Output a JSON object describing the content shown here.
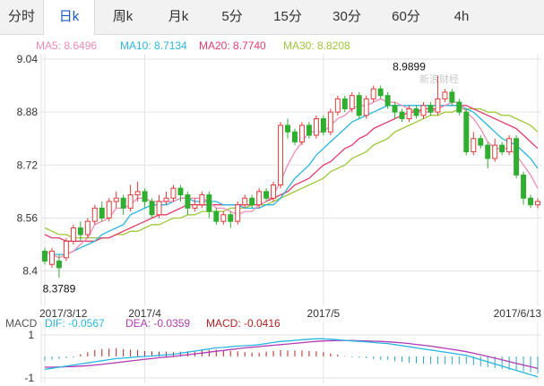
{
  "tabs": [
    {
      "label": "分时",
      "active": false
    },
    {
      "label": "日k",
      "active": true
    },
    {
      "label": "周k",
      "active": false
    },
    {
      "label": "月k",
      "active": false
    },
    {
      "label": "5分",
      "active": false
    },
    {
      "label": "15分",
      "active": false
    },
    {
      "label": "30分",
      "active": false
    },
    {
      "label": "60分",
      "active": false
    },
    {
      "label": "4h",
      "active": false
    }
  ],
  "ma_legend": [
    {
      "label": "MA5: 8.6496",
      "color": "#f08cb4"
    },
    {
      "label": "MA10: 8.7134",
      "color": "#29b6e0"
    },
    {
      "label": "MA20: 8.7740",
      "color": "#e33c6e"
    },
    {
      "label": "MA30: 8.8208",
      "color": "#9ec73a"
    }
  ],
  "macd_legend": {
    "title": "MACD",
    "items": [
      {
        "label": "DIF: -0.0567",
        "color": "#29b6e0"
      },
      {
        "label": "DEA: -0.0359",
        "color": "#b23ab4"
      },
      {
        "label": "MACD: -0.0416",
        "color": "#b22222"
      }
    ]
  },
  "watermark": "新浪财经",
  "colors": {
    "up": "#e23b3b",
    "down": "#2fae2f",
    "grid": "#e3e3e3"
  },
  "chart_data": {
    "type": "candlestick",
    "y_ticks": [
      "9.04",
      "8.88",
      "8.72",
      "8.56",
      "8.4"
    ],
    "ylim": [
      8.38,
      9.04
    ],
    "x_labels": [
      {
        "label": "2017/3/12",
        "index": 0
      },
      {
        "label": "2017/4",
        "index": 14
      },
      {
        "label": "2017/5",
        "index": 39
      },
      {
        "label": "2017/6/13",
        "index": 69
      }
    ],
    "annotations": [
      {
        "label": "8.9899",
        "value": 8.9899,
        "index": 51,
        "kind": "high"
      },
      {
        "label": "8.3789",
        "value": 8.3789,
        "index": 2,
        "kind": "low"
      }
    ],
    "candles": [
      [
        8.46,
        8.43,
        8.47,
        8.42
      ],
      [
        8.42,
        8.46,
        8.47,
        8.41
      ],
      [
        8.43,
        8.41,
        8.45,
        8.38
      ],
      [
        8.44,
        8.49,
        8.5,
        8.43
      ],
      [
        8.49,
        8.53,
        8.54,
        8.48
      ],
      [
        8.53,
        8.51,
        8.55,
        8.49
      ],
      [
        8.51,
        8.55,
        8.56,
        8.5
      ],
      [
        8.55,
        8.59,
        8.6,
        8.54
      ],
      [
        8.59,
        8.56,
        8.61,
        8.55
      ],
      [
        8.56,
        8.61,
        8.62,
        8.55
      ],
      [
        8.61,
        8.62,
        8.64,
        8.59
      ],
      [
        8.62,
        8.59,
        8.63,
        8.57
      ],
      [
        8.59,
        8.63,
        8.66,
        8.58
      ],
      [
        8.63,
        8.64,
        8.67,
        8.61
      ],
      [
        8.64,
        8.61,
        8.65,
        8.59
      ],
      [
        8.61,
        8.57,
        8.62,
        8.56
      ],
      [
        8.57,
        8.61,
        8.63,
        8.56
      ],
      [
        8.61,
        8.62,
        8.64,
        8.6
      ],
      [
        8.62,
        8.65,
        8.66,
        8.61
      ],
      [
        8.65,
        8.63,
        8.66,
        8.61
      ],
      [
        8.63,
        8.59,
        8.64,
        8.57
      ],
      [
        8.59,
        8.6,
        8.62,
        8.58
      ],
      [
        8.6,
        8.63,
        8.64,
        8.59
      ],
      [
        8.63,
        8.58,
        8.64,
        8.56
      ],
      [
        8.58,
        8.55,
        8.59,
        8.54
      ],
      [
        8.55,
        8.57,
        8.58,
        8.54
      ],
      [
        8.57,
        8.55,
        8.58,
        8.53
      ],
      [
        8.55,
        8.6,
        8.61,
        8.54
      ],
      [
        8.6,
        8.62,
        8.63,
        8.59
      ],
      [
        8.62,
        8.6,
        8.63,
        8.59
      ],
      [
        8.6,
        8.64,
        8.65,
        8.59
      ],
      [
        8.64,
        8.62,
        8.65,
        8.61
      ],
      [
        8.62,
        8.66,
        8.67,
        8.61
      ],
      [
        8.66,
        8.84,
        8.85,
        8.65
      ],
      [
        8.84,
        8.82,
        8.86,
        8.8
      ],
      [
        8.82,
        8.79,
        8.83,
        8.78
      ],
      [
        8.79,
        8.84,
        8.85,
        8.78
      ],
      [
        8.84,
        8.81,
        8.85,
        8.8
      ],
      [
        8.81,
        8.86,
        8.87,
        8.8
      ],
      [
        8.86,
        8.82,
        8.87,
        8.81
      ],
      [
        8.82,
        8.88,
        8.89,
        8.81
      ],
      [
        8.88,
        8.92,
        8.93,
        8.87
      ],
      [
        8.92,
        8.89,
        8.93,
        8.88
      ],
      [
        8.89,
        8.93,
        8.94,
        8.88
      ],
      [
        8.93,
        8.87,
        8.94,
        8.86
      ],
      [
        8.87,
        8.92,
        8.93,
        8.86
      ],
      [
        8.92,
        8.95,
        8.96,
        8.91
      ],
      [
        8.95,
        8.93,
        8.96,
        8.92
      ],
      [
        8.93,
        8.9,
        8.94,
        8.89
      ],
      [
        8.9,
        8.88,
        8.91,
        8.86
      ],
      [
        8.88,
        8.86,
        8.89,
        8.85
      ],
      [
        8.86,
        8.89,
        8.9,
        8.85
      ],
      [
        8.89,
        8.87,
        8.9,
        8.86
      ],
      [
        8.87,
        8.9,
        8.91,
        8.86
      ],
      [
        8.9,
        8.88,
        8.91,
        8.87
      ],
      [
        8.88,
        8.92,
        8.99,
        8.87
      ],
      [
        8.92,
        8.94,
        8.95,
        8.91
      ],
      [
        8.94,
        8.91,
        8.95,
        8.9
      ],
      [
        8.91,
        8.88,
        8.92,
        8.87
      ],
      [
        8.88,
        8.76,
        8.89,
        8.75
      ],
      [
        8.76,
        8.8,
        8.82,
        8.75
      ],
      [
        8.8,
        8.78,
        8.81,
        8.77
      ],
      [
        8.78,
        8.74,
        8.79,
        8.71
      ],
      [
        8.74,
        8.78,
        8.8,
        8.73
      ],
      [
        8.78,
        8.76,
        8.79,
        8.75
      ],
      [
        8.76,
        8.8,
        8.81,
        8.75
      ],
      [
        8.8,
        8.69,
        8.81,
        8.68
      ],
      [
        8.69,
        8.62,
        8.7,
        8.6
      ],
      [
        8.62,
        8.6,
        8.63,
        8.59
      ],
      [
        8.6,
        8.61,
        8.62,
        8.59
      ]
    ],
    "ma5": [
      8.46,
      8.45,
      8.44,
      8.45,
      8.46,
      8.48,
      8.5,
      8.54,
      8.55,
      8.56,
      8.59,
      8.59,
      8.6,
      8.62,
      8.62,
      8.61,
      8.61,
      8.61,
      8.61,
      8.62,
      8.62,
      8.62,
      8.62,
      8.61,
      8.59,
      8.59,
      8.58,
      8.57,
      8.58,
      8.58,
      8.6,
      8.61,
      8.63,
      8.67,
      8.72,
      8.76,
      8.79,
      8.82,
      8.82,
      8.82,
      8.84,
      8.86,
      8.87,
      8.89,
      8.9,
      8.9,
      8.91,
      8.92,
      8.91,
      8.91,
      8.9,
      8.89,
      8.88,
      8.88,
      8.88,
      8.89,
      8.9,
      8.91,
      8.91,
      8.88,
      8.86,
      8.83,
      8.79,
      8.77,
      8.77,
      8.77,
      8.75,
      8.72,
      8.69,
      8.65
    ],
    "ma10": [
      8.46,
      8.45,
      8.45,
      8.45,
      8.46,
      8.47,
      8.48,
      8.49,
      8.51,
      8.52,
      8.53,
      8.54,
      8.57,
      8.58,
      8.59,
      8.6,
      8.6,
      8.6,
      8.61,
      8.62,
      8.62,
      8.61,
      8.61,
      8.61,
      8.61,
      8.6,
      8.6,
      8.6,
      8.59,
      8.59,
      8.59,
      8.6,
      8.6,
      8.62,
      8.65,
      8.68,
      8.7,
      8.72,
      8.75,
      8.77,
      8.79,
      8.81,
      8.83,
      8.85,
      8.86,
      8.87,
      8.88,
      8.89,
      8.9,
      8.9,
      8.9,
      8.9,
      8.9,
      8.9,
      8.9,
      8.9,
      8.9,
      8.9,
      8.9,
      8.89,
      8.88,
      8.86,
      8.84,
      8.82,
      8.8,
      8.79,
      8.78,
      8.76,
      8.74,
      8.71
    ],
    "ma20": [
      8.51,
      8.5,
      8.5,
      8.49,
      8.49,
      8.49,
      8.49,
      8.49,
      8.5,
      8.5,
      8.51,
      8.52,
      8.53,
      8.54,
      8.55,
      8.56,
      8.57,
      8.57,
      8.58,
      8.59,
      8.6,
      8.6,
      8.6,
      8.6,
      8.6,
      8.6,
      8.6,
      8.6,
      8.6,
      8.6,
      8.6,
      8.61,
      8.62,
      8.63,
      8.64,
      8.66,
      8.67,
      8.68,
      8.7,
      8.72,
      8.73,
      8.75,
      8.77,
      8.78,
      8.8,
      8.81,
      8.83,
      8.84,
      8.85,
      8.86,
      8.87,
      8.88,
      8.88,
      8.89,
      8.89,
      8.89,
      8.9,
      8.9,
      8.9,
      8.9,
      8.89,
      8.88,
      8.87,
      8.86,
      8.85,
      8.84,
      8.83,
      8.81,
      8.79,
      8.77
    ],
    "ma30": [
      8.53,
      8.52,
      8.51,
      8.51,
      8.5,
      8.5,
      8.5,
      8.5,
      8.5,
      8.5,
      8.51,
      8.51,
      8.52,
      8.52,
      8.53,
      8.54,
      8.54,
      8.55,
      8.56,
      8.56,
      8.57,
      8.57,
      8.58,
      8.58,
      8.58,
      8.58,
      8.59,
      8.59,
      8.59,
      8.6,
      8.6,
      8.6,
      8.61,
      8.62,
      8.63,
      8.64,
      8.65,
      8.66,
      8.67,
      8.68,
      8.7,
      8.71,
      8.72,
      8.74,
      8.75,
      8.76,
      8.78,
      8.79,
      8.8,
      8.82,
      8.83,
      8.84,
      8.85,
      8.86,
      8.87,
      8.87,
      8.88,
      8.88,
      8.89,
      8.89,
      8.89,
      8.89,
      8.88,
      8.88,
      8.87,
      8.87,
      8.86,
      8.85,
      8.84,
      8.82
    ],
    "macd": {
      "y_ticks": [
        "1",
        "-1"
      ],
      "dif": [
        -0.6,
        -0.55,
        -0.5,
        -0.45,
        -0.4,
        -0.35,
        -0.3,
        -0.25,
        -0.2,
        -0.15,
        -0.1,
        -0.08,
        -0.05,
        -0.02,
        0,
        0.02,
        0.05,
        0.08,
        0.1,
        0.15,
        0.2,
        0.25,
        0.3,
        0.35,
        0.4,
        0.42,
        0.45,
        0.48,
        0.5,
        0.52,
        0.55,
        0.6,
        0.65,
        0.7,
        0.72,
        0.75,
        0.78,
        0.8,
        0.82,
        0.82,
        0.8,
        0.78,
        0.75,
        0.72,
        0.7,
        0.68,
        0.65,
        0.62,
        0.6,
        0.55,
        0.5,
        0.45,
        0.4,
        0.35,
        0.3,
        0.25,
        0.2,
        0.15,
        0.1,
        0.05,
        -0.05,
        -0.15,
        -0.25,
        -0.35,
        -0.45,
        -0.55,
        -0.65,
        -0.75,
        -0.85,
        -0.95
      ],
      "dea": [
        -0.5,
        -0.5,
        -0.49,
        -0.48,
        -0.47,
        -0.45,
        -0.43,
        -0.4,
        -0.37,
        -0.33,
        -0.29,
        -0.25,
        -0.21,
        -0.17,
        -0.13,
        -0.1,
        -0.06,
        -0.03,
        0,
        0.04,
        0.08,
        0.12,
        0.16,
        0.2,
        0.24,
        0.28,
        0.32,
        0.36,
        0.4,
        0.43,
        0.46,
        0.49,
        0.52,
        0.55,
        0.58,
        0.61,
        0.64,
        0.67,
        0.7,
        0.72,
        0.73,
        0.74,
        0.74,
        0.74,
        0.73,
        0.72,
        0.71,
        0.7,
        0.68,
        0.66,
        0.63,
        0.6,
        0.56,
        0.52,
        0.48,
        0.43,
        0.38,
        0.33,
        0.28,
        0.22,
        0.15,
        0.08,
        0.0,
        -0.08,
        -0.16,
        -0.24,
        -0.32,
        -0.4,
        -0.48,
        -0.56
      ],
      "hist": [
        -0.2,
        -0.15,
        -0.12,
        -0.08,
        -0.05,
        0.1,
        0.2,
        0.3,
        0.35,
        0.36,
        0.38,
        0.34,
        0.32,
        0.3,
        0.26,
        0.24,
        0.22,
        0.22,
        0.2,
        0.22,
        0.24,
        0.26,
        0.28,
        0.3,
        0.32,
        0.28,
        0.26,
        0.24,
        0.2,
        0.18,
        0.18,
        0.22,
        0.26,
        0.3,
        0.28,
        0.28,
        0.28,
        0.26,
        0.24,
        0.2,
        0.14,
        0.08,
        0.02,
        -0.04,
        -0.06,
        -0.08,
        -0.12,
        -0.16,
        -0.16,
        -0.22,
        -0.26,
        -0.3,
        -0.32,
        -0.34,
        -0.36,
        -0.36,
        -0.36,
        -0.36,
        -0.36,
        -0.34,
        -0.4,
        -0.46,
        -0.5,
        -0.54,
        -0.58,
        -0.62,
        -0.66,
        -0.7,
        -0.74,
        -0.78
      ]
    }
  }
}
